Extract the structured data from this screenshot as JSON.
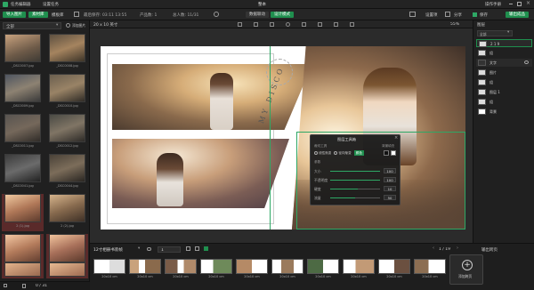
{
  "titlebar": {
    "left_items": [
      "任务编辑器",
      "设置任务"
    ],
    "center_title": "整本",
    "right_items": [
      "操作手册"
    ]
  },
  "toolbar": {
    "import_label": "导入图片",
    "tab_active": "素材库",
    "tab_other": "模板库",
    "info_time": "最后保存: 03:11 13:55",
    "info_product": "产品数: 1",
    "info_pages": "总人数: 11/31",
    "btn_data": "数据联动",
    "btn_design": "设计模式",
    "btn_settings": "设置项",
    "btn_preview": "预览",
    "btn_share": "分享",
    "btn_save": "保存",
    "btn_export": "输出成品"
  },
  "leftpanel": {
    "search_placeholder": "全部",
    "add_label": "添加图片",
    "thumbnails": [
      {
        "label": "_DSC0007.jpg"
      },
      {
        "label": "_DSC0008.jpg"
      },
      {
        "label": "_DSC0009.jpg"
      },
      {
        "label": "_DSC0010.jpg"
      },
      {
        "label": "_DSC0011.jpg"
      },
      {
        "label": "_DSC0012.jpg"
      },
      {
        "label": "_DSC0041.jpg"
      },
      {
        "label": "_DSC0044.jpg"
      },
      {
        "label": "2 (1).jpg"
      },
      {
        "label": "2 (2).jpg"
      },
      {
        "label": "2 (3).jpg"
      },
      {
        "label": "2 (4).jpg"
      },
      {
        "label": "2 (5).jpg"
      },
      {
        "label": "2 (6).jpg"
      }
    ],
    "footer_count": "0 / 31"
  },
  "canvas": {
    "size_label": "20 x 10 英寸",
    "zoom": "55%",
    "vertical_text": "MY DISCO"
  },
  "rightpanel": {
    "header": "图层",
    "filter": "全部",
    "layers": [
      {
        "label": "2 1 9"
      },
      {
        "label": "组"
      },
      {
        "label": "文字"
      },
      {
        "label": "图片"
      },
      {
        "label": "组"
      },
      {
        "label": "图层 1"
      },
      {
        "label": "组"
      },
      {
        "label": "背景"
      }
    ]
  },
  "mediapanel": {
    "title": "图层工具箱",
    "tab_label": "裁切工具",
    "tab_label2": "背景填充",
    "options": [
      "线性渐变",
      "径向渐变",
      "颜色"
    ],
    "section": "参数",
    "sliders": [
      {
        "label": "大小",
        "value": "100",
        "fill": 1.0
      },
      {
        "label": "不透明度",
        "value": "100",
        "fill": 1.0
      },
      {
        "label": "硬度",
        "value": "10",
        "fill": 0.55
      },
      {
        "label": "流量",
        "value": "50",
        "fill": 0.5
      }
    ]
  },
  "bottombar": {
    "title": "12寸相册书装帧",
    "page_select": "1",
    "page_count": "1 / 19",
    "output": "输出跨页",
    "add_page": "添加跨页",
    "spread_label": "20x10 cm"
  },
  "colors": {
    "accent": "#1f8f4e",
    "bg": "#1a1a1a",
    "panel": "#202020"
  }
}
